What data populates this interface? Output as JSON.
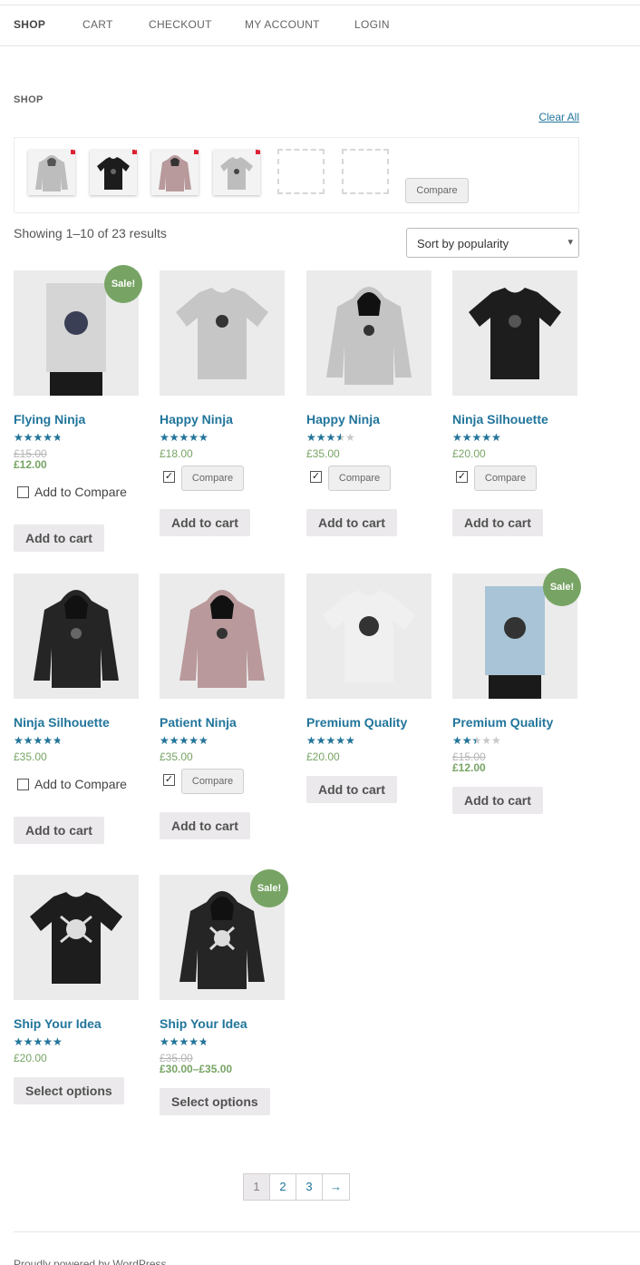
{
  "nav": {
    "items": [
      "SHOP",
      "CART",
      "CHECKOUT",
      "MY ACCOUNT",
      "LOGIN"
    ]
  },
  "breadcrumb": "SHOP",
  "compare_bar": {
    "clear_all": "Clear All",
    "compare_button": "Compare",
    "remove_glyph": "×"
  },
  "result_count": "Showing 1–10 of 23 results",
  "sort": {
    "selected": "Sort by popularity"
  },
  "labels": {
    "sale": "Sale!",
    "add_to_compare": "Add to Compare",
    "compare": "Compare"
  },
  "products": [
    {
      "title": "Flying Ninja",
      "rating": 4.0,
      "old_price": "£15.00",
      "price": "£12.00",
      "sale": true,
      "compare_mode": "checkbox",
      "checked": false,
      "button": "Add to cart",
      "image": "poster"
    },
    {
      "title": "Happy Ninja",
      "rating": 5.0,
      "old_price": "",
      "price": "£18.00",
      "sale": false,
      "compare_mode": "button",
      "checked": true,
      "button": "Add to cart",
      "image": "tshirt-grey"
    },
    {
      "title": "Happy Ninja",
      "rating": 3.0,
      "old_price": "",
      "price": "£35.00",
      "sale": false,
      "compare_mode": "button",
      "checked": true,
      "button": "Add to cart",
      "image": "hoodie-grey"
    },
    {
      "title": "Ninja Silhouette",
      "rating": 5.0,
      "old_price": "",
      "price": "£20.00",
      "sale": false,
      "compare_mode": "button",
      "checked": true,
      "button": "Add to cart",
      "image": "tshirt-black"
    },
    {
      "title": "Ninja Silhouette",
      "rating": 4.0,
      "old_price": "",
      "price": "£35.00",
      "sale": false,
      "compare_mode": "checkbox",
      "checked": false,
      "button": "Add to cart",
      "image": "hoodie-black"
    },
    {
      "title": "Patient Ninja",
      "rating": 4.7,
      "old_price": "",
      "price": "£35.00",
      "sale": false,
      "compare_mode": "button",
      "checked": true,
      "button": "Add to cart",
      "image": "hoodie-pink"
    },
    {
      "title": "Premium Quality",
      "rating": 4.5,
      "old_price": "",
      "price": "£20.00",
      "sale": false,
      "compare_mode": "none",
      "checked": false,
      "button": "Add to cart",
      "image": "tshirt-white"
    },
    {
      "title": "Premium Quality",
      "rating": 2.0,
      "old_price": "£15.00",
      "price": "£12.00",
      "sale": true,
      "compare_mode": "none",
      "checked": false,
      "button": "Add to cart",
      "image": "poster-blue"
    },
    {
      "title": "Ship Your Idea",
      "rating": 4.5,
      "old_price": "",
      "price": "£20.00",
      "sale": false,
      "compare_mode": "none",
      "checked": false,
      "button": "Select options",
      "image": "tshirt-skull"
    },
    {
      "title": "Ship Your Idea",
      "rating": 4.0,
      "old_price": "£35.00",
      "price": "£30.00–£35.00",
      "sale": true,
      "compare_mode": "none",
      "checked": false,
      "button": "Select options",
      "image": "hoodie-skull"
    }
  ],
  "pagination": {
    "pages": [
      "1",
      "2",
      "3"
    ],
    "next": "→",
    "current": "1"
  },
  "footer": "Proudly powered by WordPress",
  "colors": {
    "link": "#21759b",
    "sale": "#77a464",
    "star": "#21759b"
  }
}
